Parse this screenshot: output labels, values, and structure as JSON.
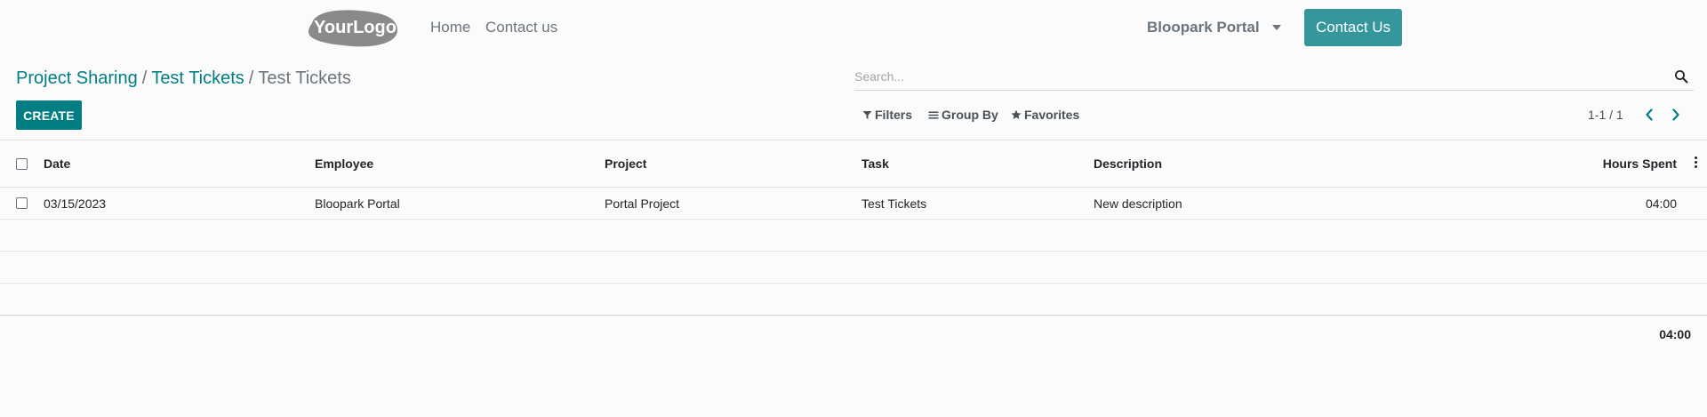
{
  "navbar": {
    "logo_text": "YourLogo",
    "links": {
      "home": "Home",
      "contact": "Contact us"
    },
    "user_menu": "Bloopark Portal",
    "contact_button": "Contact Us"
  },
  "breadcrumb": {
    "items": [
      "Project Sharing",
      "Test Tickets",
      "Test Tickets"
    ],
    "separator": "/"
  },
  "actions": {
    "create_label": "CREATE"
  },
  "search": {
    "placeholder": "Search..."
  },
  "filters": {
    "filters_label": "Filters",
    "group_by_label": "Group By",
    "favorites_label": "Favorites"
  },
  "pager": {
    "value": "1-1 / 1"
  },
  "table": {
    "columns": [
      "Date",
      "Employee",
      "Project",
      "Task",
      "Description",
      "Hours Spent"
    ],
    "rows": [
      {
        "date": "03/15/2023",
        "employee": "Bloopark Portal",
        "project": "Portal Project",
        "task": "Test Tickets",
        "description": "New description",
        "hours_spent": "04:00"
      }
    ],
    "total_hours": "04:00"
  },
  "colors": {
    "primary": "#017e84",
    "contact_button": "#35979c",
    "muted_text": "#6c757d"
  },
  "icons": {
    "search": "search-icon",
    "filter": "filter-icon",
    "group_by": "bars-icon",
    "favorites": "star-icon",
    "pager_prev": "chevron-left-icon",
    "pager_next": "chevron-right-icon",
    "column_options": "ellipsis-vertical-icon",
    "user_caret": "caret-down-icon"
  }
}
